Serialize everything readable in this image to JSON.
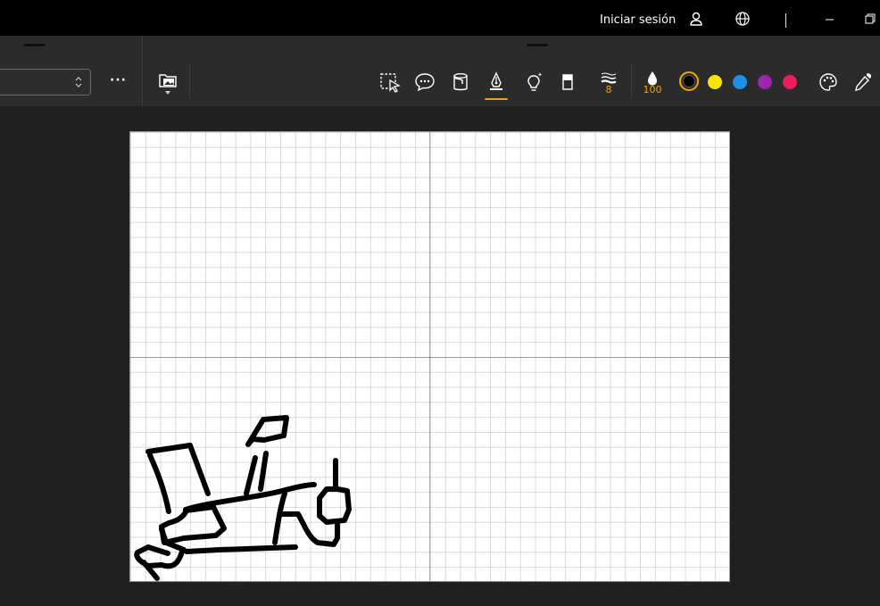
{
  "titlebar": {
    "signin_label": "Iniciar sesión",
    "icons": [
      "user-icon",
      "globe-icon",
      "minimize-icon",
      "restore-icon"
    ]
  },
  "toolbar": {
    "page_select_value": "",
    "more_label": "···",
    "stroke_width_value": "8",
    "opacity_value": "100",
    "active_tool": "pen",
    "tools": [
      "insert-image-icon",
      "lasso-select-icon",
      "comment-icon",
      "paint-bucket-icon",
      "pen-nib-icon",
      "highlighter-bulb-icon",
      "eraser-icon",
      "stroke-width-icon",
      "opacity-drop-icon",
      "palette-icon",
      "eyedropper-icon"
    ],
    "colors": [
      {
        "name": "black",
        "hex": "#000000",
        "selected": true
      },
      {
        "name": "yellow",
        "hex": "#f5e500"
      },
      {
        "name": "blue",
        "hex": "#1e90e8"
      },
      {
        "name": "purple",
        "hex": "#9b27af"
      },
      {
        "name": "red",
        "hex": "#e91e5a"
      }
    ],
    "accent": "#f0a500"
  }
}
